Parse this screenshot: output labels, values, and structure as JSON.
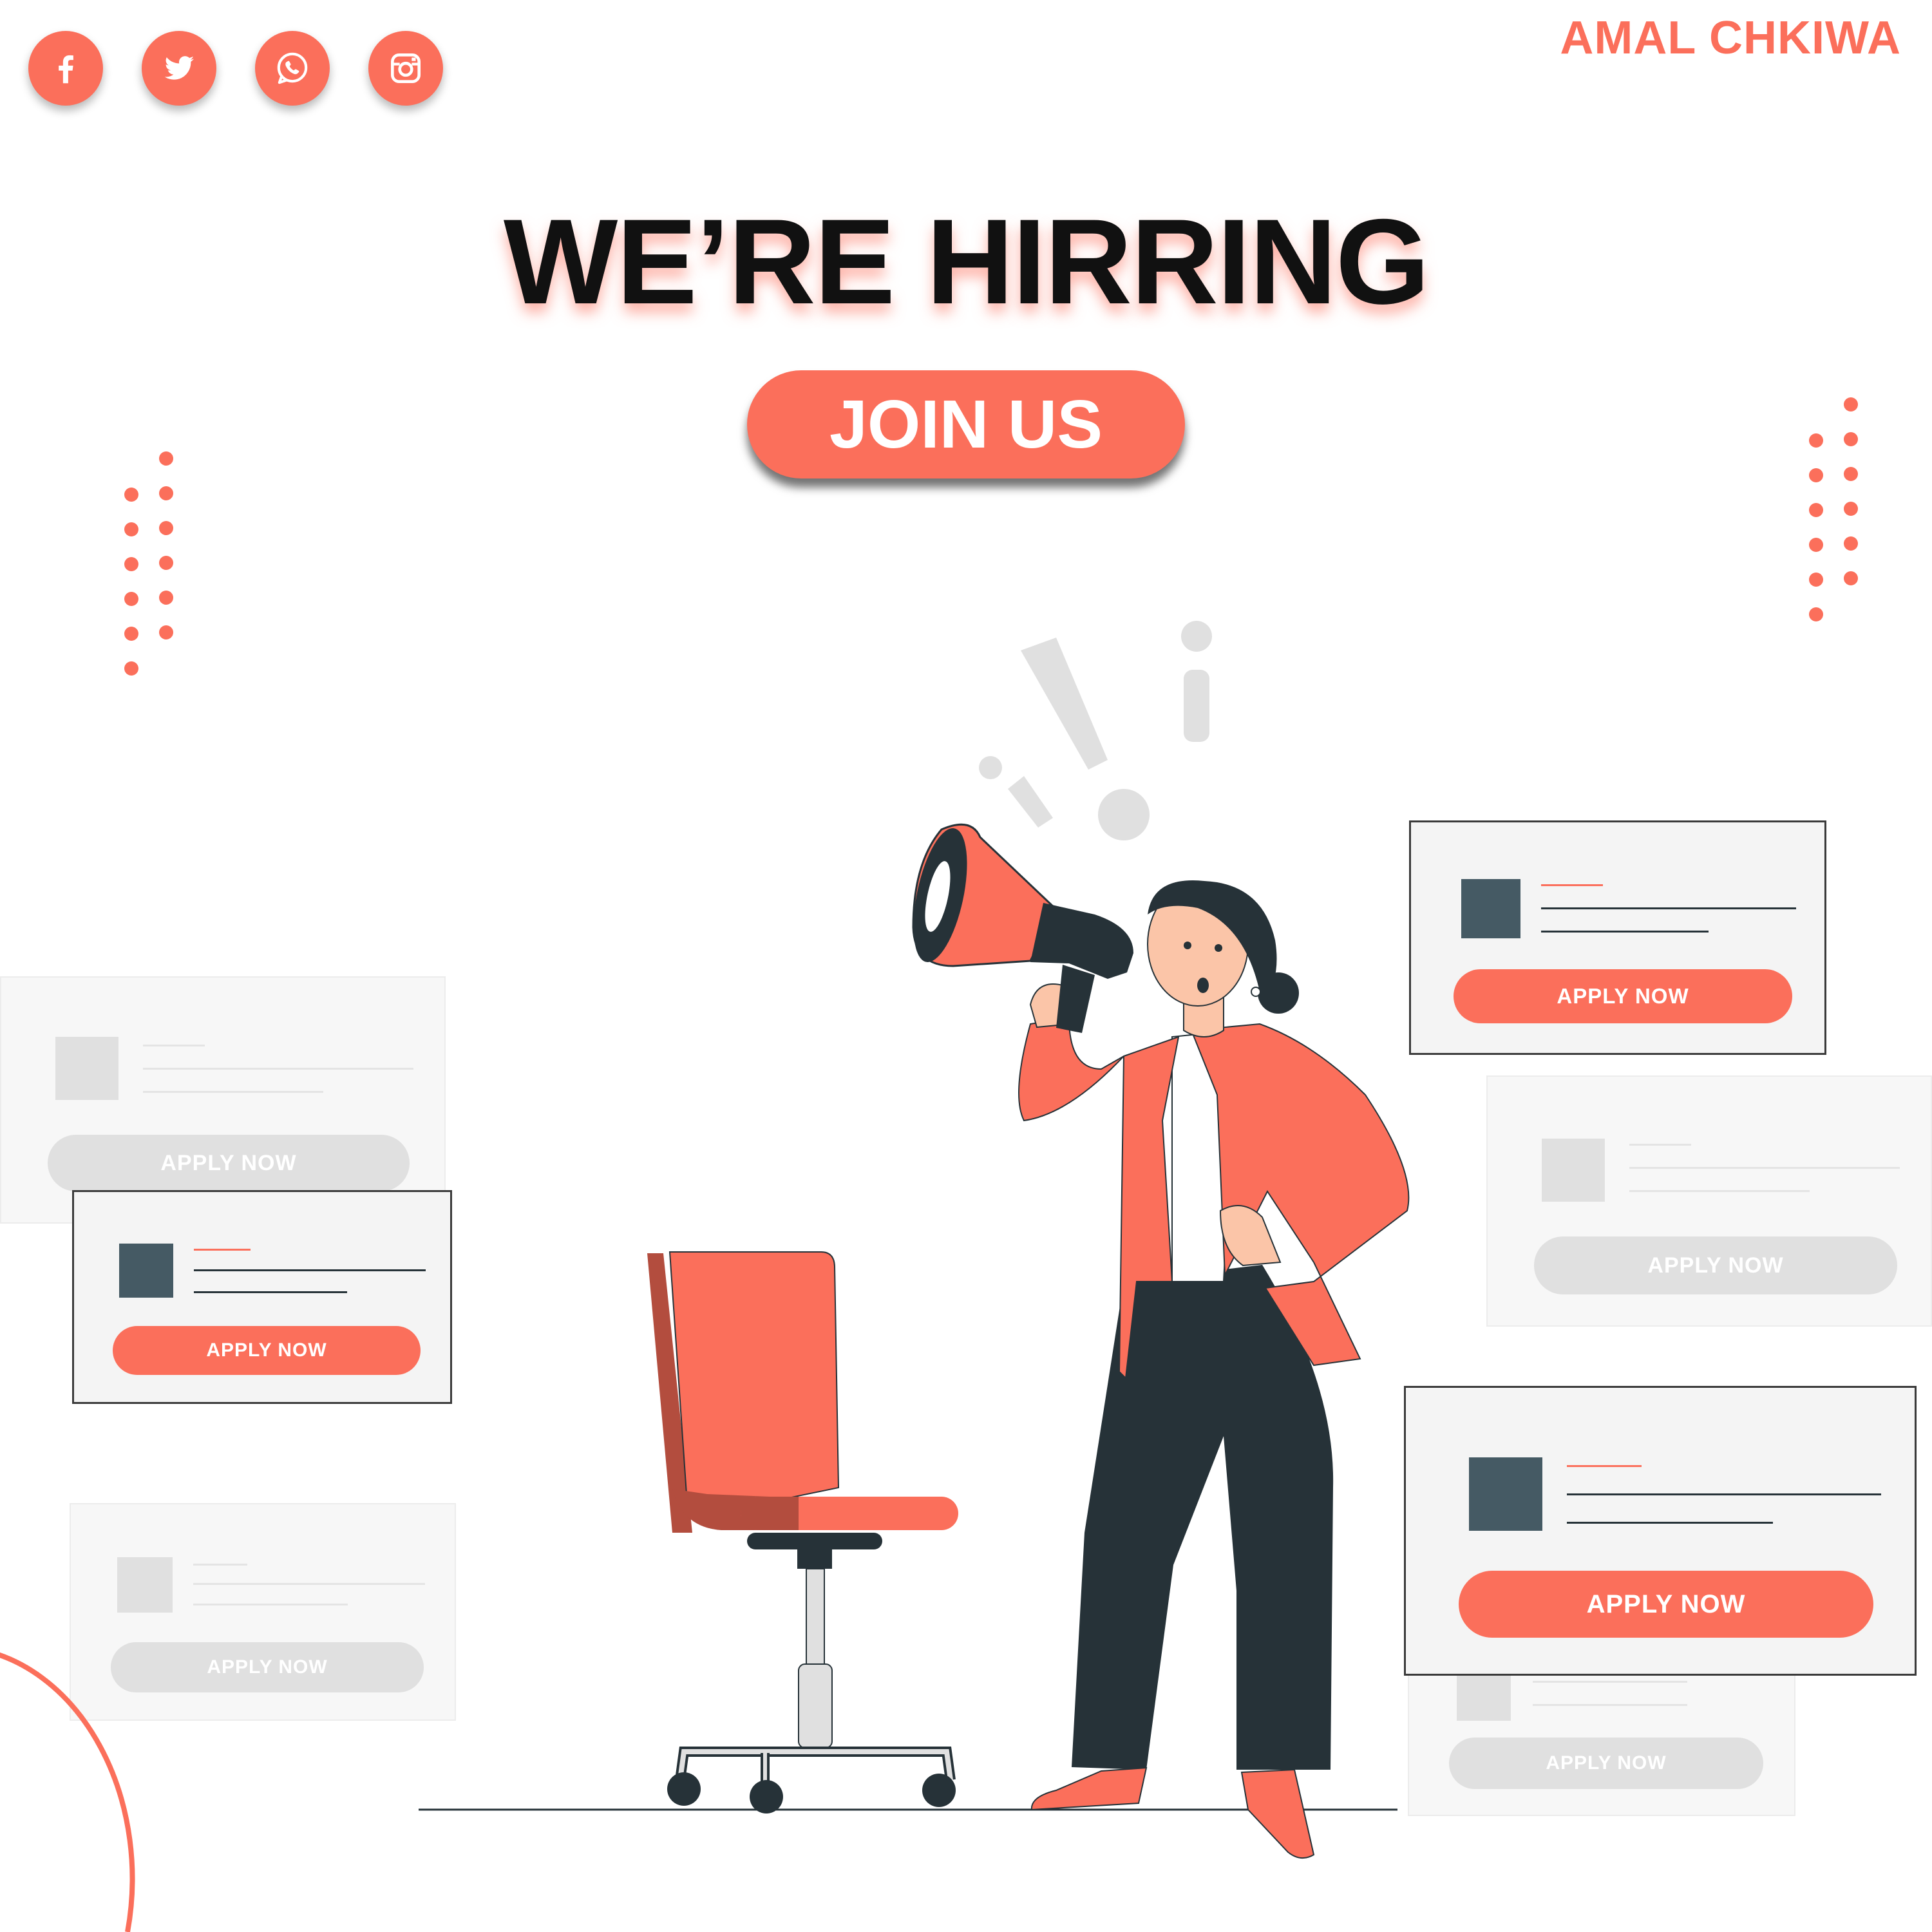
{
  "brand": {
    "name": "AMAL CHKIWA"
  },
  "social_links": [
    {
      "name": "facebook",
      "icon": "facebook-icon"
    },
    {
      "name": "twitter",
      "icon": "twitter-icon"
    },
    {
      "name": "whatsapp",
      "icon": "whatsapp-icon"
    },
    {
      "name": "instagram",
      "icon": "instagram-icon"
    }
  ],
  "headline": "WE’RE HIRRING",
  "cta": {
    "label": "JOIN US"
  },
  "job_cards": [
    {
      "label": "APPLY NOW",
      "style": "ghost"
    },
    {
      "label": "APPLY NOW",
      "style": "active"
    },
    {
      "label": "APPLY NOW",
      "style": "ghost"
    },
    {
      "label": "APPLY NOW",
      "style": "active"
    },
    {
      "label": "APPLY NOW",
      "style": "ghost"
    },
    {
      "label": "APPLY NOW",
      "style": "active"
    },
    {
      "label": "APPLY NOW",
      "style": "ghost"
    }
  ],
  "colors": {
    "accent": "#fb6f5b",
    "dark": "#263238",
    "placeholder": "#455a64",
    "ghost": "#e0e0e0"
  }
}
